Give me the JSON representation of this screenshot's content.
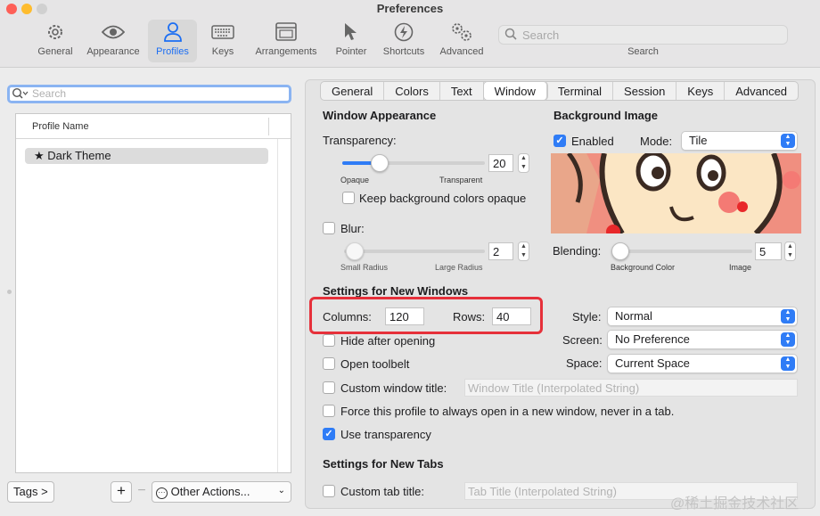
{
  "window": {
    "title": "Preferences"
  },
  "toolbar": {
    "items": [
      {
        "label": "General",
        "icon": "gear-icon"
      },
      {
        "label": "Appearance",
        "icon": "eye-icon"
      },
      {
        "label": "Profiles",
        "icon": "person-icon",
        "active": true
      },
      {
        "label": "Keys",
        "icon": "keyboard-icon"
      },
      {
        "label": "Arrangements",
        "icon": "window-icon"
      },
      {
        "label": "Pointer",
        "icon": "pointer-icon"
      },
      {
        "label": "Shortcuts",
        "icon": "bolt-icon"
      },
      {
        "label": "Advanced",
        "icon": "gears-icon"
      }
    ],
    "search_placeholder": "Search",
    "search_label": "Search"
  },
  "profiles": {
    "search_placeholder": "Search",
    "column_header": "Profile Name",
    "items": [
      {
        "name": "Dark Theme",
        "default": true
      }
    ],
    "tags_button": "Tags >",
    "add_button": "+",
    "remove_button": "−",
    "other_actions": "Other Actions..."
  },
  "tabs": [
    "General",
    "Colors",
    "Text",
    "Window",
    "Terminal",
    "Session",
    "Keys",
    "Advanced"
  ],
  "active_tab": "Window",
  "window_appearance": {
    "title": "Window Appearance",
    "transparency_label": "Transparency:",
    "transparency_value": "20",
    "transparency_fraction": 0.2,
    "opaque_label": "Opaque",
    "transparent_label": "Transparent",
    "keep_bg_opaque_label": "Keep background colors opaque",
    "keep_bg_opaque_checked": false,
    "blur_label": "Blur:",
    "blur_checked": false,
    "blur_value": "2",
    "small_radius_label": "Small Radius",
    "large_radius_label": "Large Radius"
  },
  "background_image": {
    "title": "Background Image",
    "enabled_label": "Enabled",
    "enabled_checked": true,
    "mode_label": "Mode:",
    "mode_value": "Tile",
    "blending_label": "Blending:",
    "blending_value": "5",
    "background_color_label": "Background Color",
    "image_label": "Image"
  },
  "new_windows": {
    "title": "Settings for New Windows",
    "columns_label": "Columns:",
    "columns_value": "120",
    "rows_label": "Rows:",
    "rows_value": "40",
    "style_label": "Style:",
    "style_value": "Normal",
    "screen_label": "Screen:",
    "screen_value": "No Preference",
    "space_label": "Space:",
    "space_value": "Current Space",
    "hide_after_opening_label": "Hide after opening",
    "open_toolbelt_label": "Open toolbelt",
    "custom_title_label": "Custom window title:",
    "custom_title_placeholder": "Window Title (Interpolated String)",
    "force_new_window_label": "Force this profile to always open in a new window, never in a tab.",
    "use_transparency_label": "Use transparency",
    "use_transparency_checked": true
  },
  "new_tabs": {
    "title": "Settings for New Tabs",
    "custom_tab_title_label": "Custom tab title:",
    "custom_tab_title_placeholder": "Tab Title (Interpolated String)"
  },
  "watermark": "@稀土掘金技术社区",
  "colors": {
    "accent": "#2f7cf6",
    "highlight": "#e6303a",
    "image_bg": "#f08f80"
  }
}
